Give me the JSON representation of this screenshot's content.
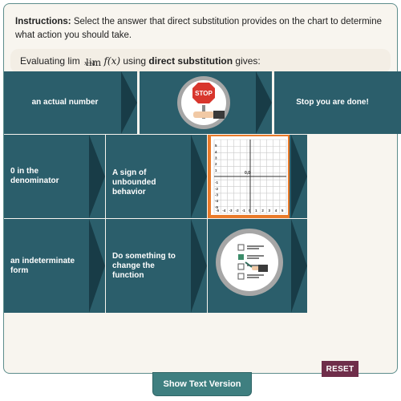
{
  "instructions": {
    "label": "Instructions:",
    "text": " Select the answer that direct substitution provides on the chart to determine what action you should take."
  },
  "prompt": {
    "prefix": "Evaluating lim",
    "lim_word": "lim",
    "lim_sub": "x→a",
    "func": "f(x)",
    "middle": " using ",
    "bold": "direct substitution",
    "suffix": " gives:"
  },
  "rows": [
    {
      "answer": "an actual number",
      "meaning_icon": "stop-sign-icon",
      "action": "Stop you are done!"
    },
    {
      "answer": "0 in the denominator",
      "meaning": "A sign of unbounded behavior",
      "action_icon": "coordinate-graph-icon"
    },
    {
      "answer": "an indeterminate form",
      "meaning": "Do something to change the function",
      "action_icon": "checklist-icon"
    }
  ],
  "stop_sign": {
    "text": "STOP"
  },
  "graph": {
    "y_ticks": [
      "5",
      "4",
      "3",
      "2",
      "1",
      "-1",
      "-2",
      "-3",
      "-4",
      "-5"
    ],
    "x_ticks": [
      "-5",
      "-4",
      "-3",
      "-2",
      "-1",
      "0",
      "1",
      "2",
      "3",
      "4",
      "5"
    ],
    "origin_label": "0,0"
  },
  "buttons": {
    "reset": "RESET",
    "text_version": "Show Text Version"
  },
  "colors": {
    "tile": "#2b5e6b",
    "tile_arrow": "#183c47",
    "reset": "#6f2e4a",
    "text_version": "#3f7f80"
  }
}
